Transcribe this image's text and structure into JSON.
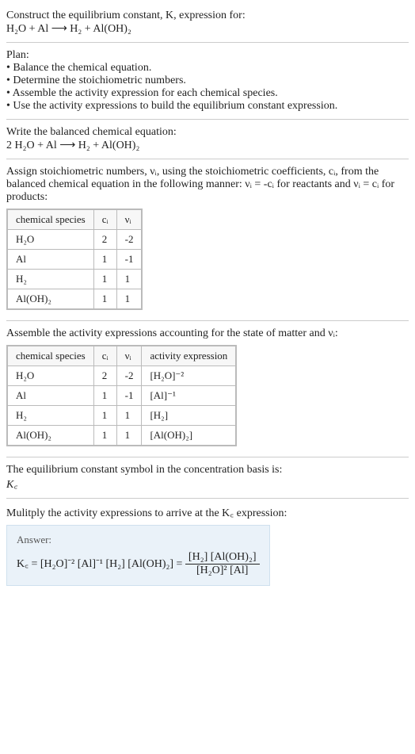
{
  "prompt": {
    "line1": "Construct the equilibrium constant, K, expression for:",
    "eq": "H₂O + Al ⟶ H₂ + Al(OH)₂"
  },
  "plan": {
    "heading": "Plan:",
    "items": [
      "Balance the chemical equation.",
      "Determine the stoichiometric numbers.",
      "Assemble the activity expression for each chemical species.",
      "Use the activity expressions to build the equilibrium constant expression."
    ]
  },
  "balanced": {
    "heading": "Write the balanced chemical equation:",
    "eq": "2 H₂O + Al ⟶ H₂ + Al(OH)₂"
  },
  "stoich": {
    "text": "Assign stoichiometric numbers, νᵢ, using the stoichiometric coefficients, cᵢ, from the balanced chemical equation in the following manner: νᵢ = -cᵢ for reactants and νᵢ = cᵢ for products:",
    "headers": [
      "chemical species",
      "cᵢ",
      "νᵢ"
    ],
    "rows": [
      {
        "sp": "H₂O",
        "c": "2",
        "v": "-2"
      },
      {
        "sp": "Al",
        "c": "1",
        "v": "-1"
      },
      {
        "sp": "H₂",
        "c": "1",
        "v": "1"
      },
      {
        "sp": "Al(OH)₂",
        "c": "1",
        "v": "1"
      }
    ]
  },
  "activity": {
    "text": "Assemble the activity expressions accounting for the state of matter and νᵢ:",
    "headers": [
      "chemical species",
      "cᵢ",
      "νᵢ",
      "activity expression"
    ],
    "rows": [
      {
        "sp": "H₂O",
        "c": "2",
        "v": "-2",
        "a": "[H₂O]⁻²"
      },
      {
        "sp": "Al",
        "c": "1",
        "v": "-1",
        "a": "[Al]⁻¹"
      },
      {
        "sp": "H₂",
        "c": "1",
        "v": "1",
        "a": "[H₂]"
      },
      {
        "sp": "Al(OH)₂",
        "c": "1",
        "v": "1",
        "a": "[Al(OH)₂]"
      }
    ]
  },
  "symbol": {
    "text": "The equilibrium constant symbol in the concentration basis is:",
    "sym": "K꜀"
  },
  "multiply": {
    "text": "Mulitply the activity expressions to arrive at the K꜀ expression:"
  },
  "answer": {
    "label": "Answer:",
    "lhs": "K꜀ = [H₂O]⁻² [Al]⁻¹ [H₂] [Al(OH)₂] = ",
    "frac_num": "[H₂] [Al(OH)₂]",
    "frac_den": "[H₂O]² [Al]"
  }
}
